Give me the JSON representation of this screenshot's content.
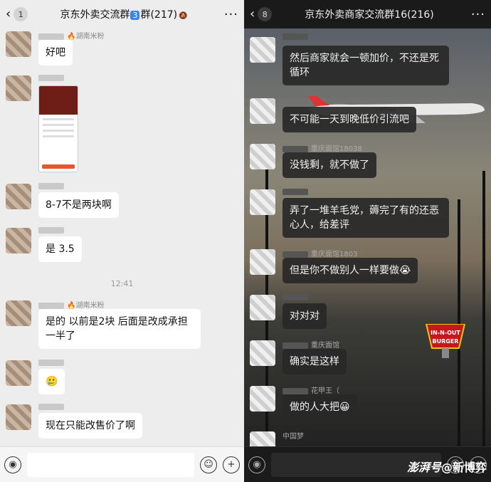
{
  "left": {
    "header": {
      "back_count": "1",
      "title_pre": "京东外卖交流群",
      "title_num": "3",
      "title_post": "群(217)",
      "mute_icon": "bell-off-icon"
    },
    "messages": [
      {
        "name_suffix": "湖南米粉",
        "text": "好吧"
      },
      {
        "name_suffix": "",
        "text": ""
      },
      {
        "name_suffix": "",
        "text": "8-7不是两块啊"
      },
      {
        "name_suffix": "",
        "text": "是 3.5"
      },
      {
        "name_suffix": "湖南米粉",
        "text": "是的  以前是2块  后面是改成承担一半了"
      },
      {
        "name_suffix": "",
        "text": "🥲"
      },
      {
        "name_suffix": "",
        "text": "现在只能改售价了啊"
      }
    ],
    "time": "12:41",
    "input": {
      "placeholder": ""
    }
  },
  "right": {
    "header": {
      "back_count": "8",
      "title": "京东外卖商家交流群16(216)"
    },
    "messages": [
      {
        "name_suffix": "",
        "text": "然后商家就会一顿加价，不还是死循环"
      },
      {
        "name_suffix": "",
        "text": "不可能一天到晚低价引流吧"
      },
      {
        "name_suffix": "重庆面馆18038",
        "text": "没钱剩，就不做了"
      },
      {
        "name_suffix": "",
        "text": "弄了一堆羊毛党，薅完了有的还恶心人，给差评"
      },
      {
        "name_suffix": "重庆面馆1803",
        "text": "但是你不做别人一样要做😭"
      },
      {
        "name_suffix": "",
        "text": "对对对"
      },
      {
        "name_suffix": "重庆面馆",
        "text": "确实是这样"
      },
      {
        "name_suffix": "花甲王（",
        "text": "做的人大把😀"
      },
      {
        "name_suffix": "中国梦",
        "text": ""
      }
    ],
    "sign_text": [
      "IN-N-OUT",
      "BURGER"
    ],
    "watermark": {
      "brand": "澎湃号",
      "author": "@新博弈"
    }
  },
  "colors": {
    "left_bg": "#ededed",
    "right_bg": "#1d1f24",
    "badge_blue": "#3a86e8"
  }
}
